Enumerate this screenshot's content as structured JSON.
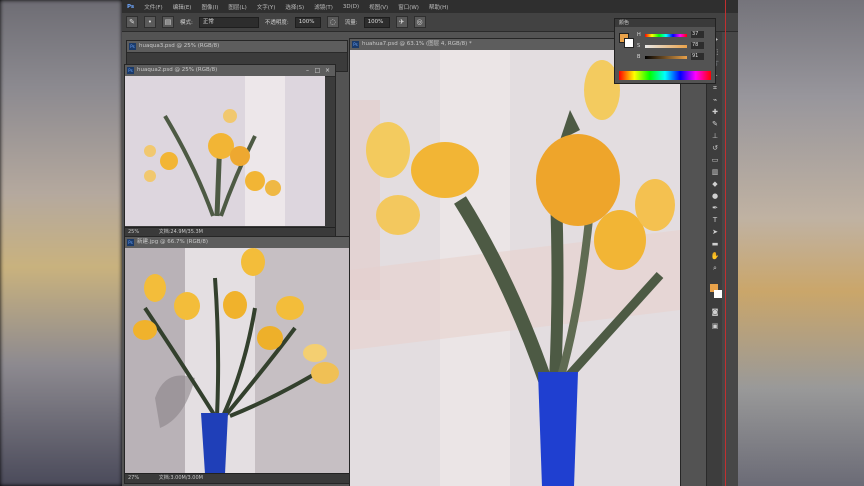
{
  "menu": {
    "items": [
      "文件(F)",
      "编辑(E)",
      "图像(I)",
      "图层(L)",
      "文字(Y)",
      "选择(S)",
      "滤镜(T)",
      "3D(D)",
      "视图(V)",
      "窗口(W)",
      "帮助(H)"
    ]
  },
  "options_bar": {
    "mode_label": "模式:",
    "mode_value": "正常",
    "opacity_label": "不透明度:",
    "opacity_value": "100%",
    "flow_label": "流量:",
    "flow_value": "100%"
  },
  "documents": {
    "doc_a": {
      "title": "huaqua3.psd @ 25% (RGB/8)"
    },
    "doc_b": {
      "title": "huaqua2.psd @ 25% (RGB/8)",
      "zoom": "25%",
      "status": "文档:24.9M/35.3M"
    },
    "doc_c": {
      "title": "新建.jpg @ 66.7% (RGB/8)",
      "zoom": "27%",
      "status": "文档:3.00M/3.00M"
    },
    "main": {
      "title": "huahua7.psd @ 63.1% (图层 4, RGB/8) *"
    }
  },
  "color_panel": {
    "tab": "颜色",
    "sliders": [
      {
        "label": "H",
        "value": "37"
      },
      {
        "label": "S",
        "value": "78"
      },
      {
        "label": "B",
        "value": "91"
      }
    ],
    "foreground": "#e9a24a",
    "background": "#ffffff"
  },
  "colors": {
    "vase": "#1f3fd0",
    "tulip": "#f2b535",
    "stem": "#4d5a44",
    "bg_canvas": "#e3dde0"
  }
}
